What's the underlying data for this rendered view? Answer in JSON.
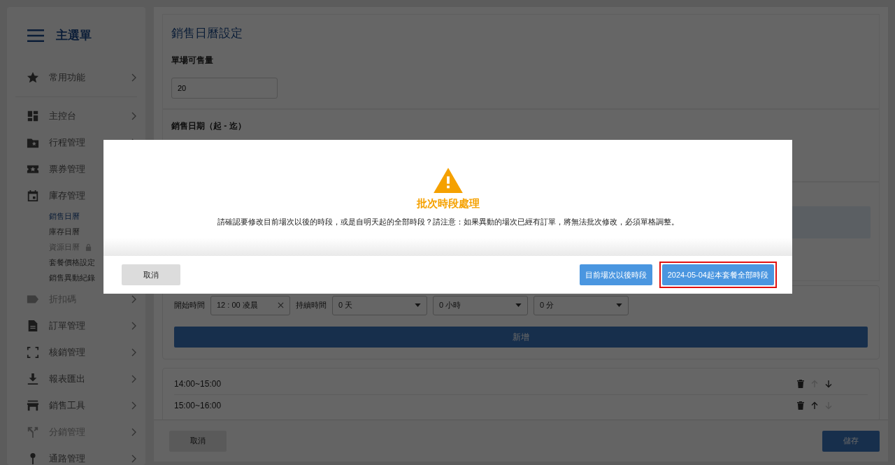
{
  "sidebar": {
    "title": "主選單",
    "favorites": [
      {
        "label": "常用功能",
        "disabled": false
      }
    ],
    "items": [
      {
        "label": "主控台",
        "disabled": false
      },
      {
        "label": "行程管理",
        "disabled": false
      },
      {
        "label": "票券管理",
        "disabled": false
      },
      {
        "label": "庫存管理",
        "disabled": false,
        "children": [
          {
            "label": "銷售日曆",
            "selected": true,
            "disabled": false,
            "locked": false
          },
          {
            "label": "庫存日曆",
            "selected": false,
            "disabled": false,
            "locked": false
          },
          {
            "label": "資源日曆",
            "selected": false,
            "disabled": true,
            "locked": true
          },
          {
            "label": "套餐價格設定",
            "selected": false,
            "disabled": false,
            "locked": false
          },
          {
            "label": "銷售異動紀錄",
            "selected": false,
            "disabled": false,
            "locked": false
          }
        ]
      },
      {
        "label": "折扣碼",
        "disabled": true
      },
      {
        "label": "訂單管理",
        "disabled": false
      },
      {
        "label": "核銷管理",
        "disabled": false
      },
      {
        "label": "報表匯出",
        "disabled": false
      },
      {
        "label": "銷售工具",
        "disabled": false
      },
      {
        "label": "分銷管理",
        "disabled": true
      },
      {
        "label": "通路管理",
        "disabled": false
      }
    ]
  },
  "main": {
    "title": "銷售日曆設定",
    "quantity": {
      "label": "單場可售量",
      "value": "20"
    },
    "date_range": {
      "label": "銷售日期（起 - 迄）"
    },
    "time_form": {
      "start_label": "開始時間",
      "start_value": "12 : 00 凌晨",
      "duration_label": "持續時間",
      "selects": [
        "0 天",
        "0 小時",
        "0 分"
      ],
      "add_button": "新增"
    },
    "slots": [
      {
        "label": "14:00~15:00",
        "up_disabled": true,
        "down_disabled": false
      },
      {
        "label": "15:00~16:00",
        "up_disabled": false,
        "down_disabled": true
      }
    ]
  },
  "footer": {
    "cancel": "取消",
    "save": "儲存"
  },
  "dialog": {
    "title": "批次時段處理",
    "message": "請確認要修改目前場次以後的時段，或是自明天起的全部時段？請注意：如果異動的場次已經有訂單，將無法批次修改，必須單格調整。",
    "buttons": [
      {
        "label": "取消",
        "kind": "secondary",
        "highlighted": false
      },
      {
        "label": "目前場次以後時段",
        "kind": "primary",
        "highlighted": false
      },
      {
        "label": "2024-05-04起本套餐全部時段",
        "kind": "primary",
        "highlighted": true
      }
    ]
  }
}
